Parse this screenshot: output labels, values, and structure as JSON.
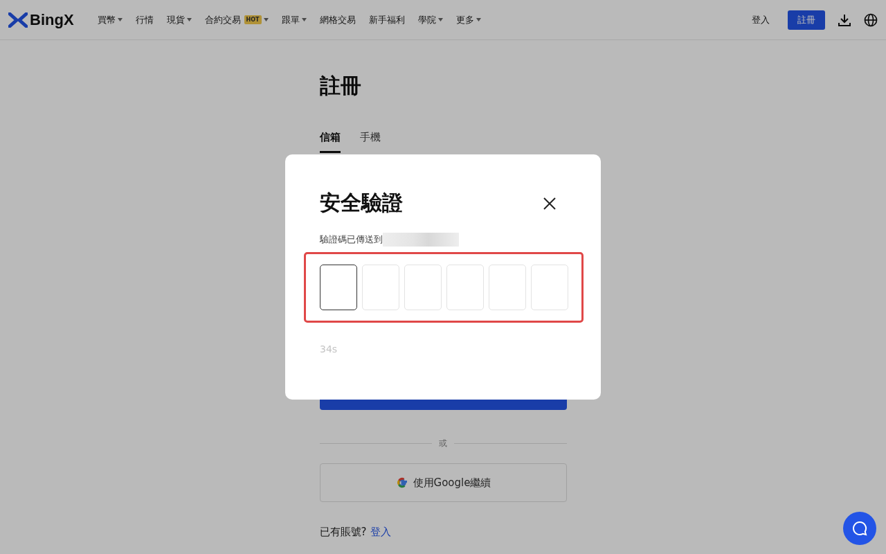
{
  "header": {
    "logo": "BingX",
    "nav": [
      {
        "label": "買幣",
        "dropdown": true
      },
      {
        "label": "行情",
        "dropdown": false
      },
      {
        "label": "現貨",
        "dropdown": true
      },
      {
        "label": "合約交易",
        "dropdown": true,
        "badge": "HOT"
      },
      {
        "label": "跟單",
        "dropdown": true
      },
      {
        "label": "網格交易",
        "dropdown": false
      },
      {
        "label": "新手福利",
        "dropdown": false
      },
      {
        "label": "學院",
        "dropdown": true
      },
      {
        "label": "更多",
        "dropdown": true
      }
    ],
    "login": "登入",
    "register": "註冊"
  },
  "page": {
    "title": "註冊",
    "tabs": [
      {
        "label": "信箱",
        "selected": true
      },
      {
        "label": "手機",
        "selected": false
      }
    ],
    "divider": "或",
    "google_button": "使用Google繼續",
    "account_prompt": "已有賬號?",
    "login_link": "登入"
  },
  "dialog": {
    "title": "安全驗證",
    "sent_to": "驗證碼已傳送到",
    "code_boxes": [
      {
        "selected": true
      },
      {
        "selected": false
      },
      {
        "selected": false
      },
      {
        "selected": false
      },
      {
        "selected": false
      },
      {
        "selected": false
      }
    ],
    "countdown": "34s"
  }
}
